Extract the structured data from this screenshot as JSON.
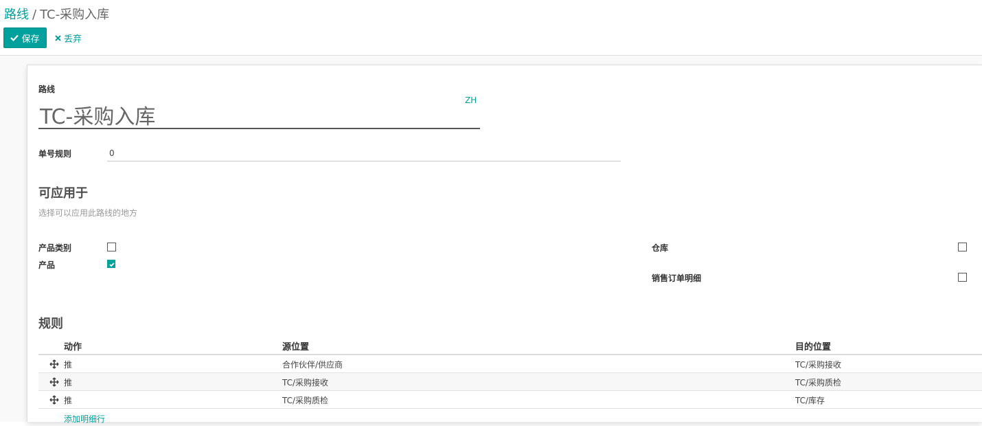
{
  "breadcrumb": {
    "parent": "路线",
    "separator": "/",
    "current": "TC-采购入库"
  },
  "toolbar": {
    "save_label": "保存",
    "discard_label": "丢弃"
  },
  "form": {
    "name_label": "路线",
    "name_value": "TC-采购入库",
    "lang_label": "ZH",
    "sequence_label": "单号规则",
    "sequence_value": "0"
  },
  "applicable": {
    "title": "可应用于",
    "hint": "选择可以应用此路线的地方",
    "options": [
      {
        "label": "产品类别",
        "checked": false
      },
      {
        "label": "产品",
        "checked": true
      },
      {
        "label": "仓库",
        "checked": false
      },
      {
        "label": "销售订单明细",
        "checked": false
      }
    ]
  },
  "rules": {
    "title": "规则",
    "columns": [
      "动作",
      "源位置",
      "目的位置"
    ],
    "rows": [
      {
        "action": "推",
        "source": "合作伙伴/供应商",
        "dest": "TC/采购接收"
      },
      {
        "action": "推",
        "source": "TC/采购接收",
        "dest": "TC/采购质检"
      },
      {
        "action": "推",
        "source": "TC/采购质检",
        "dest": "TC/库存"
      }
    ],
    "add_line_label": "添加明细行"
  },
  "colors": {
    "accent": "#00a09d",
    "text": "#4c4c4c",
    "muted": "#999999"
  }
}
